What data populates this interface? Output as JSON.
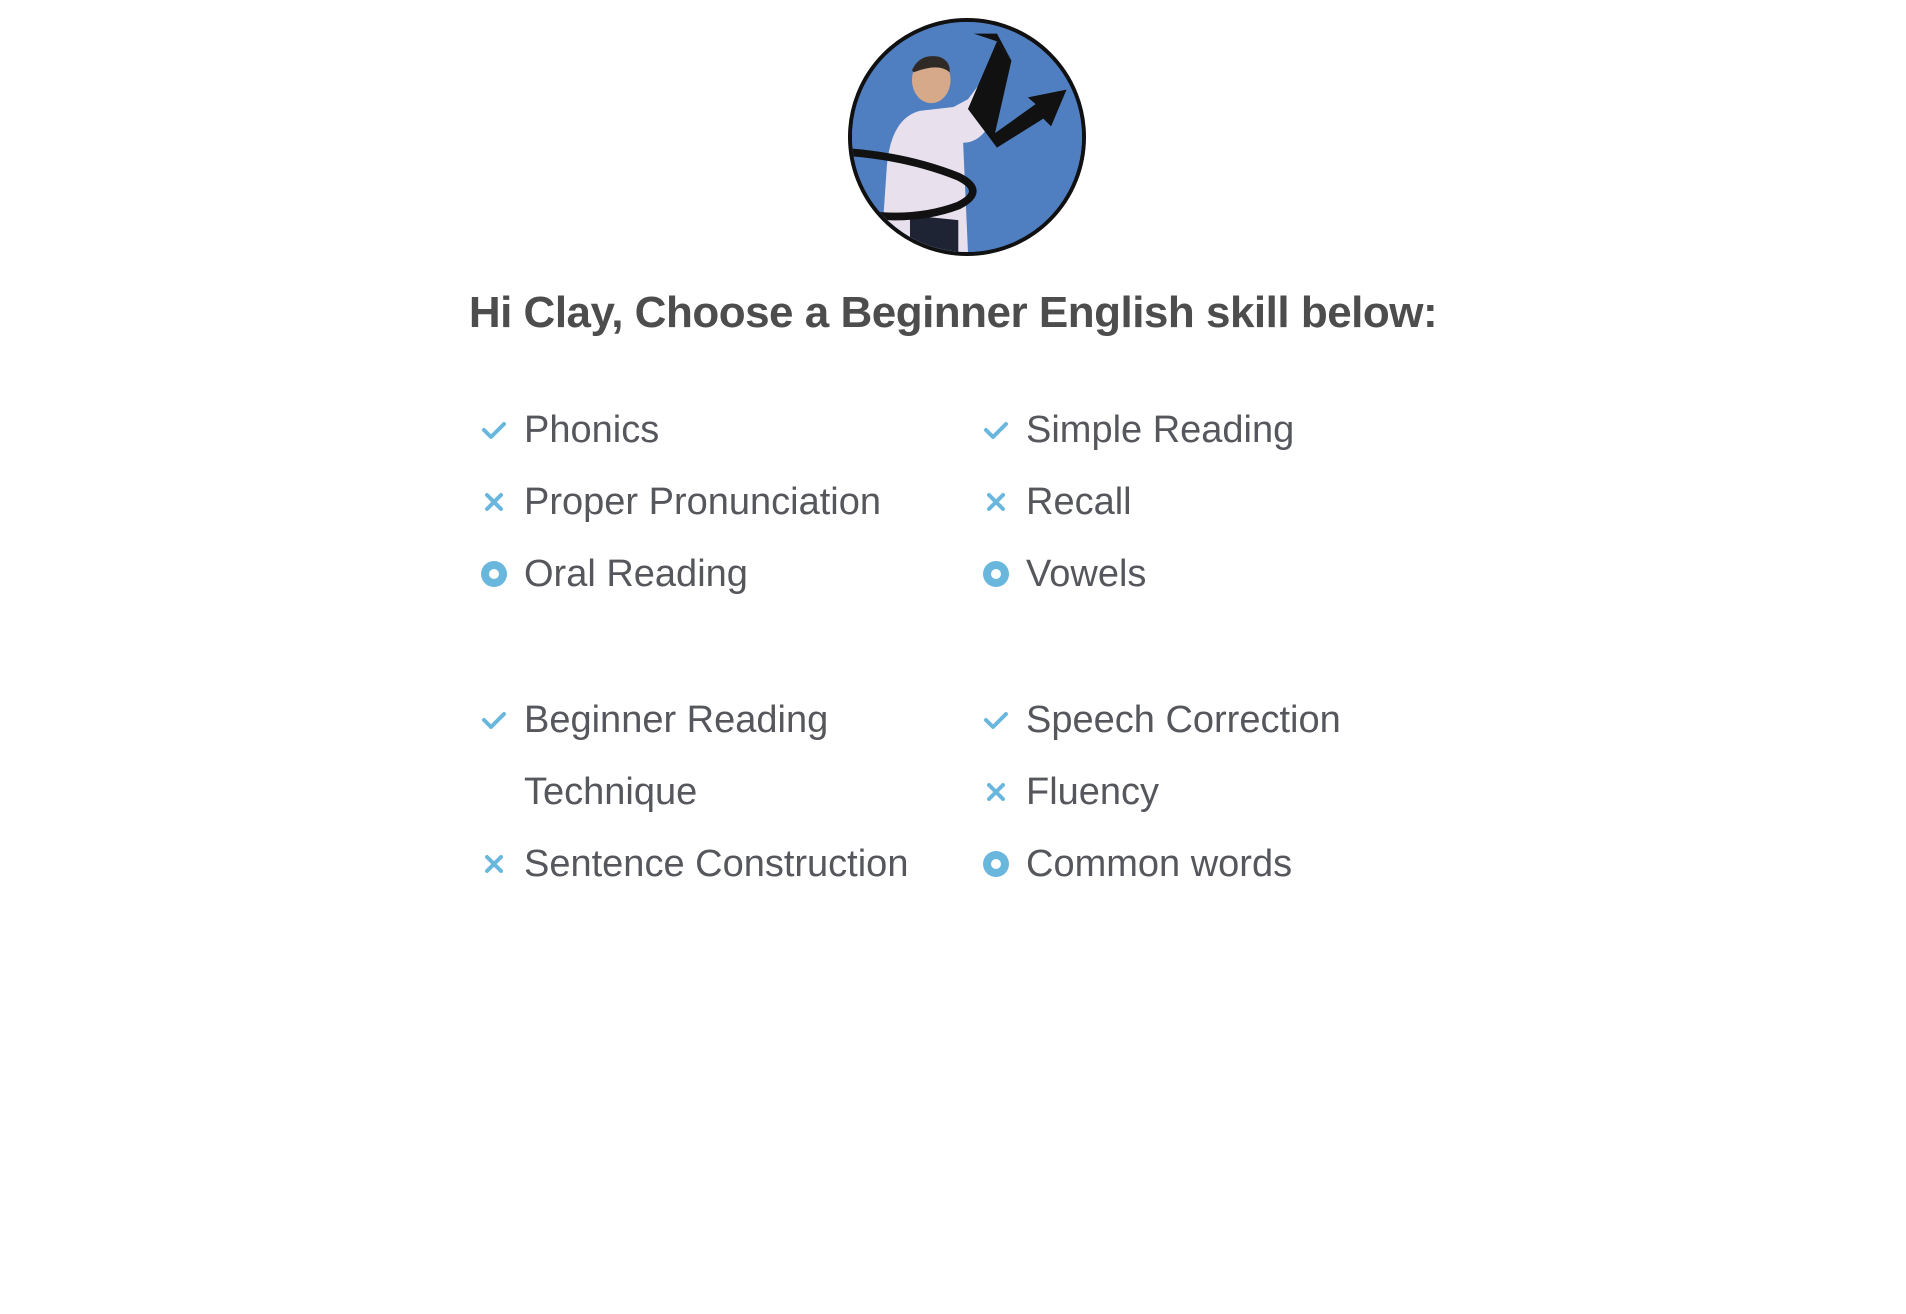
{
  "header": {
    "avatar_alt": "Profile photo",
    "heading": "Hi Clay, Choose a Beginner English skill below:"
  },
  "colors": {
    "icon_accent": "#6ab7de",
    "heading_text": "#4d4d4d",
    "skill_text": "#55575c"
  },
  "groups": [
    {
      "left": [
        {
          "label": "Phonics",
          "icon": "check-icon"
        },
        {
          "label": "Proper Pronunciation",
          "icon": "x-icon"
        },
        {
          "label": "Oral Reading",
          "icon": "dot-circle-icon"
        }
      ],
      "right": [
        {
          "label": "Simple Reading",
          "icon": "check-icon"
        },
        {
          "label": "Recall",
          "icon": "x-icon"
        },
        {
          "label": "Vowels",
          "icon": "dot-circle-icon"
        }
      ]
    },
    {
      "left": [
        {
          "label": "Beginner Reading",
          "icon": "check-icon"
        },
        {
          "label": "Technique",
          "icon": "none"
        },
        {
          "label": "Sentence Construction",
          "icon": "x-icon"
        }
      ],
      "right": [
        {
          "label": "Speech Correction",
          "icon": "check-icon"
        },
        {
          "label": "Fluency",
          "icon": "x-icon"
        },
        {
          "label": "Common words",
          "icon": "dot-circle-icon"
        }
      ]
    }
  ]
}
